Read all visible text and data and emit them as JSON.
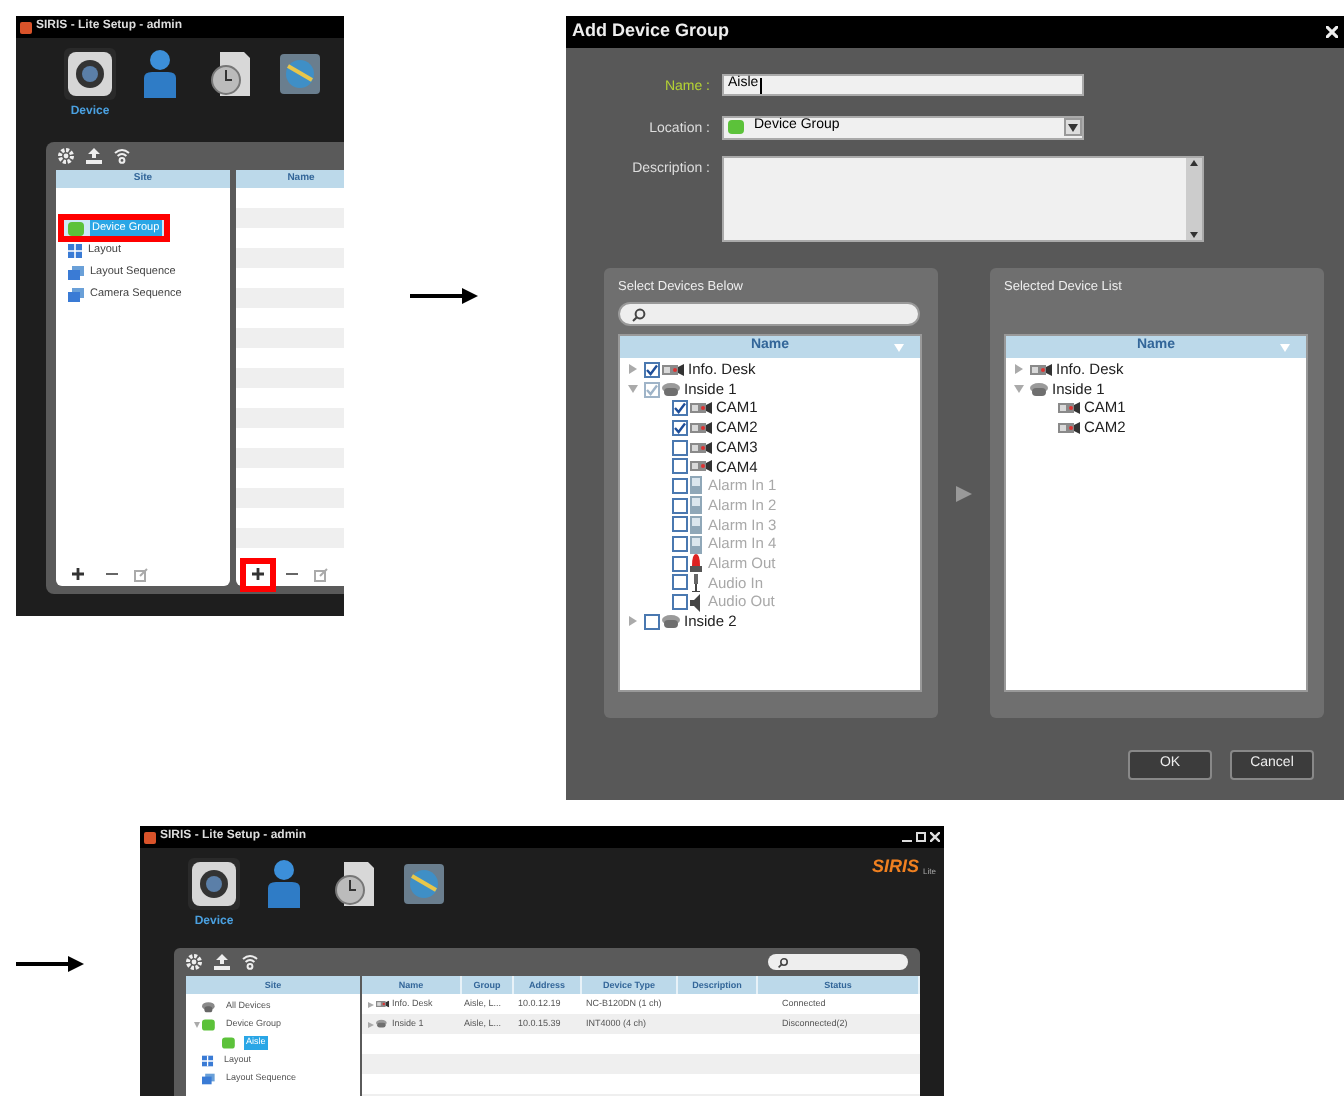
{
  "step1": {
    "window": {
      "title": "SIRIS - Lite Setup - admin"
    },
    "nav": [
      {
        "kind": "camera",
        "label": "Device",
        "selected": true
      },
      {
        "kind": "user",
        "selected": false
      },
      {
        "kind": "schedule",
        "selected": false
      },
      {
        "kind": "disk",
        "selected": false
      }
    ],
    "site_header": "Site",
    "name_header": "Name",
    "site_items": [
      {
        "kind": "group",
        "label": "Device Group",
        "selected": true,
        "marked": true
      },
      {
        "kind": "layout",
        "label": "Layout",
        "selected": false,
        "marked": false
      },
      {
        "kind": "sequence",
        "label": "Layout Sequence",
        "selected": false,
        "marked": false
      },
      {
        "kind": "sequence",
        "label": "Camera Sequence",
        "selected": false,
        "marked": false
      }
    ],
    "add_button_marked": true
  },
  "dialog": {
    "title": "Add Device Group",
    "fields": [
      {
        "kind": "text",
        "label": "Name :",
        "value": "Aisle",
        "focused": true
      },
      {
        "kind": "select",
        "label": "Location :",
        "value": "Device Group"
      },
      {
        "kind": "textarea",
        "label": "Description :"
      }
    ],
    "available": {
      "title": "Select Devices Below",
      "header": "Name",
      "items": [
        {
          "kind": "camera",
          "label": "Info. Desk",
          "checked": true,
          "dimmed": false,
          "expanded": false
        },
        {
          "kind": "encoder",
          "label": "Inside 1",
          "checked": true,
          "mixed": true,
          "dimmed": false,
          "expanded": true,
          "children": [
            {
              "kind": "camera",
              "label": "CAM1",
              "checked": true,
              "mixed": false,
              "dimmed": false
            },
            {
              "kind": "camera",
              "label": "CAM2",
              "checked": true,
              "mixed": false,
              "dimmed": false
            },
            {
              "kind": "camera",
              "label": "CAM3",
              "checked": false,
              "mixed": false,
              "dimmed": false
            },
            {
              "kind": "camera",
              "label": "CAM4",
              "checked": false,
              "mixed": false,
              "dimmed": false
            },
            {
              "kind": "alarm_in",
              "label": "Alarm In 1",
              "checked": false,
              "mixed": false,
              "dimmed": true
            },
            {
              "kind": "alarm_in",
              "label": "Alarm In 2",
              "checked": false,
              "mixed": false,
              "dimmed": true
            },
            {
              "kind": "alarm_in",
              "label": "Alarm In 3",
              "checked": false,
              "mixed": false,
              "dimmed": true
            },
            {
              "kind": "alarm_in",
              "label": "Alarm In 4",
              "checked": false,
              "mixed": false,
              "dimmed": true
            },
            {
              "kind": "alarm_out",
              "label": "Alarm Out",
              "checked": false,
              "mixed": false,
              "dimmed": true
            },
            {
              "kind": "audio_in",
              "label": "Audio In",
              "checked": false,
              "mixed": false,
              "dimmed": true
            },
            {
              "kind": "audio_out",
              "label": "Audio Out",
              "checked": false,
              "mixed": false,
              "dimmed": true
            }
          ]
        },
        {
          "kind": "encoder",
          "label": "Inside 2",
          "checked": false,
          "dimmed": false,
          "expanded": false
        }
      ]
    },
    "selected_list": {
      "title": "Selected Device List",
      "header": "Name",
      "items": [
        {
          "kind": "camera",
          "label": "Info. Desk",
          "dimmed": false,
          "expanded": false
        },
        {
          "kind": "encoder",
          "label": "Inside 1",
          "dimmed": false,
          "expanded": true,
          "children": [
            {
              "kind": "camera",
              "label": "CAM1",
              "dimmed": false
            },
            {
              "kind": "camera",
              "label": "CAM2",
              "dimmed": false
            }
          ]
        }
      ]
    },
    "buttons": [
      "OK",
      "Cancel"
    ]
  },
  "step3": {
    "window": {
      "title": "SIRIS - Lite Setup - admin"
    },
    "logo": {
      "name": "SIRIS",
      "edition": "Lite"
    },
    "nav": [
      {
        "kind": "camera",
        "label": "Device",
        "selected": true
      },
      {
        "kind": "user",
        "selected": false
      },
      {
        "kind": "schedule",
        "selected": false
      },
      {
        "kind": "disk",
        "selected": false
      }
    ],
    "site_header": "Site",
    "site_items": [
      {
        "kind": "all",
        "label": "All Devices",
        "selected": false
      },
      {
        "kind": "group",
        "label": "Device Group",
        "selected": false,
        "expanded": true,
        "children": [
          {
            "kind": "group",
            "label": "Aisle",
            "selected": true
          }
        ]
      },
      {
        "kind": "layout",
        "label": "Layout",
        "selected": false
      },
      {
        "kind": "sequence",
        "label": "Layout Sequence",
        "selected": false
      }
    ],
    "columns": [
      "Name",
      "Group",
      "Address",
      "Device Type",
      "Description",
      "Status"
    ],
    "rows": [
      {
        "kind": "camera",
        "name": "Info. Desk",
        "group": "Aisle, L...",
        "address": "10.0.12.19",
        "device_type": "NC-B120DN (1 ch)",
        "status": "Connected"
      },
      {
        "kind": "encoder",
        "name": "Inside 1",
        "group": "Aisle, L...",
        "address": "10.0.15.39",
        "device_type": "INT4000 (4 ch)",
        "status": "Disconnected(2)"
      }
    ]
  }
}
